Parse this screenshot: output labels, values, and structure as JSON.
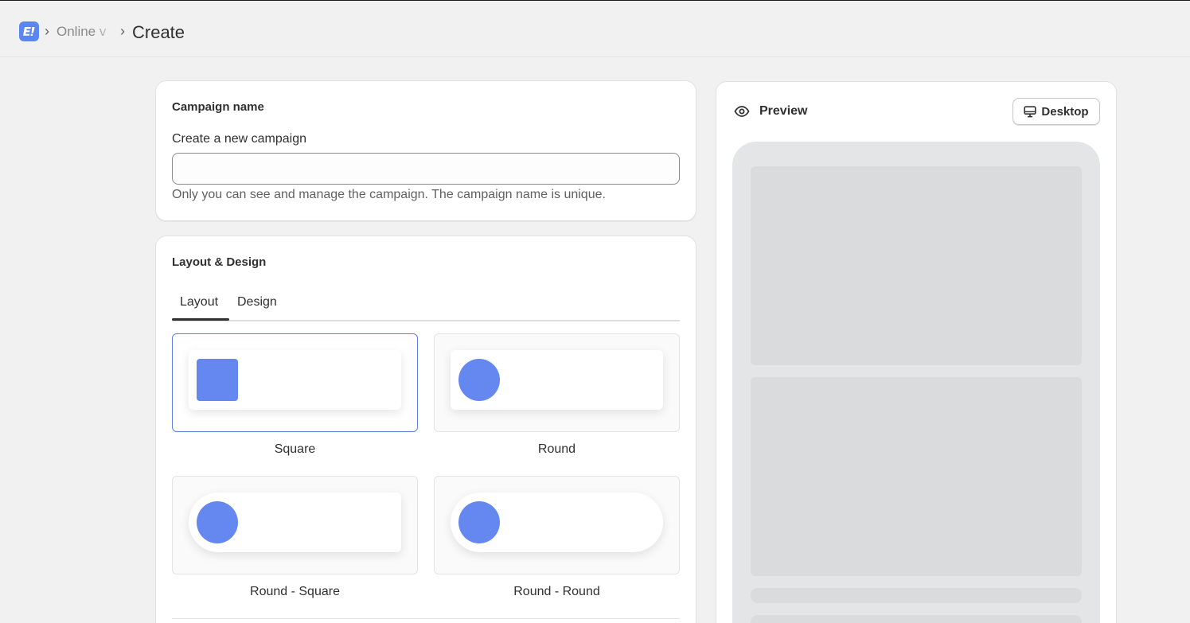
{
  "header": {
    "app_logo_text": "E!",
    "breadcrumb_separator": "›",
    "breadcrumb_parent": "Online v",
    "page_title": "Create"
  },
  "campaign": {
    "title": "Campaign name",
    "label": "Create a new campaign",
    "value": "",
    "help": "Only you can see and manage the campaign. The campaign name is unique."
  },
  "layout_design": {
    "title": "Layout & Design",
    "tabs": [
      "Layout",
      "Design"
    ],
    "active_tab": "Layout",
    "options": [
      {
        "label": "Square",
        "selected": true
      },
      {
        "label": "Round",
        "selected": false
      },
      {
        "label": "Round - Square",
        "selected": false
      },
      {
        "label": "Round - Round",
        "selected": false
      }
    ]
  },
  "preview": {
    "title": "Preview",
    "device_button": "Desktop"
  },
  "colors": {
    "accent": "#6488f0",
    "selected_border": "#5b7fe6",
    "page_bg": "#f1f1f1",
    "placeholder_block": "#d9dbdc"
  },
  "icons": [
    "app-logo-icon",
    "chevron-right-icon",
    "eye-icon",
    "desktop-icon"
  ]
}
